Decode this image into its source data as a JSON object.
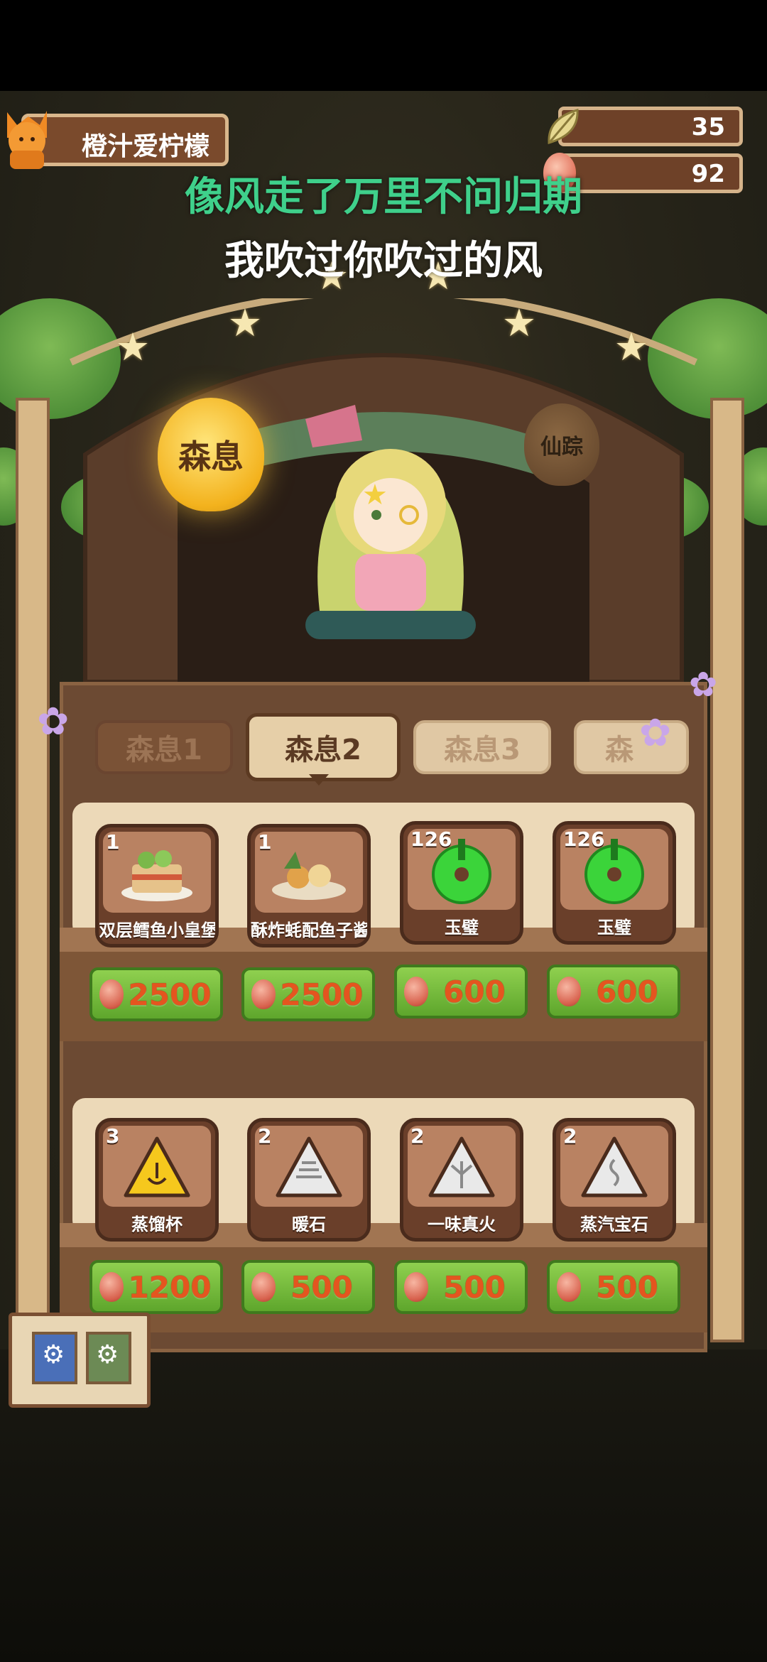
{
  "player": {
    "name": "橙汁爱柠檬"
  },
  "resources": [
    {
      "icon": "leaf-icon",
      "value": "35"
    },
    {
      "icon": "egg-icon",
      "value": "92"
    }
  ],
  "subtitles": {
    "line1": "像风走了万里不问归期",
    "line2": "我吹过你吹过的风"
  },
  "lanterns": {
    "main": "森息",
    "side": "仙踪"
  },
  "tabs": [
    "森息1",
    "森息2",
    "森息3",
    "森"
  ],
  "active_tab": "森息2",
  "shop_rows": [
    {
      "items": [
        {
          "count": "1",
          "name": "双层鳕鱼小皇堡",
          "price": "2500"
        },
        {
          "count": "1",
          "name": "酥炸蚝配鱼子酱",
          "price": "2500"
        },
        {
          "count": "126",
          "name": "玉璧",
          "price": "600"
        },
        {
          "count": "126",
          "name": "玉璧",
          "price": "600"
        }
      ]
    },
    {
      "items": [
        {
          "count": "3",
          "name": "蒸馏杯",
          "price": "1200"
        },
        {
          "count": "2",
          "name": "暖石",
          "price": "500"
        },
        {
          "count": "2",
          "name": "一味真火",
          "price": "500"
        },
        {
          "count": "2",
          "name": "蒸汽宝石",
          "price": "500"
        }
      ]
    }
  ],
  "colors": {
    "accent_green": "#3fd08b",
    "price_orange": "#e4551f",
    "button_green": "#6fb63a"
  }
}
